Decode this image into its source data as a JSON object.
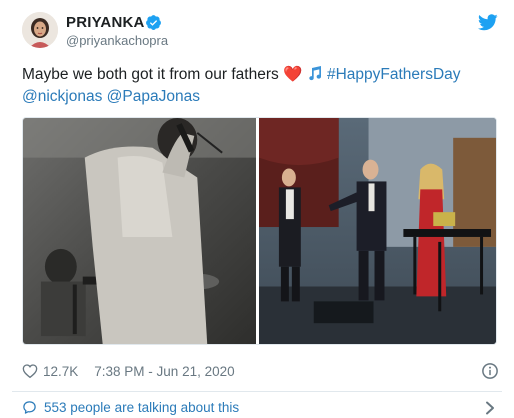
{
  "tweet": {
    "display_name": "PRIYANKA",
    "handle": "@priyankachopra",
    "text_prefix": "Maybe we both got it from our fathers ",
    "hashtag": "#HappyFathersDay",
    "mentions": [
      "@nickjonas",
      "@PapaJonas"
    ],
    "likes": "12.7K",
    "timestamp": "7:38 PM - Jun 21, 2020",
    "talking": "553 people are talking about this"
  },
  "colors": {
    "link": "#2b7bb9",
    "meta_gray": "#697882",
    "twitter_blue": "#1da1f2",
    "heart_red": "#be1931"
  },
  "icons": {
    "verified": "verified-badge-icon",
    "brand": "twitter-bird-icon",
    "like": "heart-outline-icon",
    "info": "info-icon",
    "reply": "speech-bubble-icon",
    "more": "chevron-right-icon"
  }
}
